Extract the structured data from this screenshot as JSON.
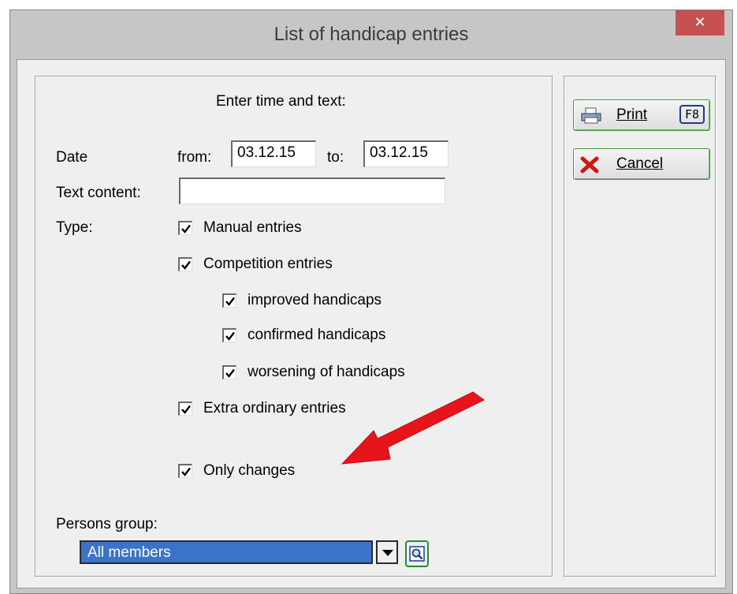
{
  "window": {
    "title": "List of handicap entries",
    "close_glyph": "✕"
  },
  "form": {
    "heading": "Enter time and text:",
    "date_label": "Date",
    "from_label": "from:",
    "from_value": "03.12.15",
    "to_label": "to:",
    "to_value": "03.12.15",
    "text_content_label": "Text content:",
    "text_content_value": "",
    "type_label": "Type:",
    "checkboxes": [
      {
        "label": "Manual entries",
        "checked": true
      },
      {
        "label": "Competition entries",
        "checked": true
      },
      {
        "label": "improved handicaps",
        "checked": true
      },
      {
        "label": "confirmed handicaps",
        "checked": true
      },
      {
        "label": "worsening of handicaps",
        "checked": true
      },
      {
        "label": "Extra ordinary entries",
        "checked": true
      },
      {
        "label": "Only changes",
        "checked": true
      }
    ],
    "persons_group_label": "Persons group:",
    "persons_group_value": "All members"
  },
  "actions": {
    "print_label": "Print",
    "print_key": "F8",
    "print_icon": "printer-icon",
    "cancel_label": "Cancel",
    "cancel_icon": "red-x-icon"
  },
  "colors": {
    "accent_green": "#3c9a3c",
    "close_red": "#c75050",
    "selection_blue": "#3b73c9",
    "annotation_arrow": "#e8141b"
  }
}
